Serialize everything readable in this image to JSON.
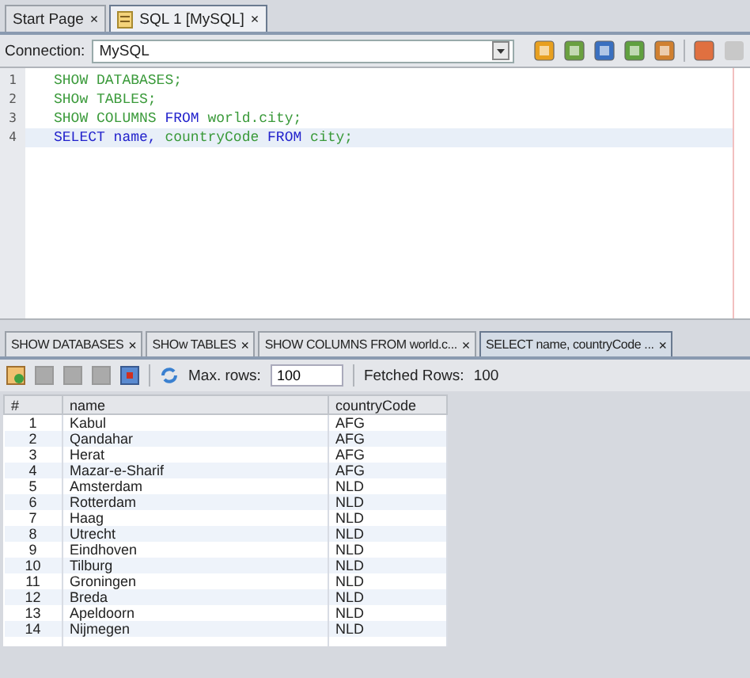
{
  "editor_tabs": [
    {
      "label": "Start Page",
      "close": "×",
      "selected": false,
      "icon": false
    },
    {
      "label": "SQL 1 [MySQL]",
      "close": "×",
      "selected": true,
      "icon": true
    }
  ],
  "connection": {
    "label": "Connection:",
    "value": "MySQL"
  },
  "code_lines": [
    {
      "number": "1",
      "current": false,
      "tokens": [
        {
          "text": "SHOW DATABASES;",
          "kind": "plain"
        }
      ]
    },
    {
      "number": "2",
      "current": false,
      "tokens": [
        {
          "text": "SHOw TABLES;",
          "kind": "plain"
        }
      ]
    },
    {
      "number": "3",
      "current": false,
      "tokens": [
        {
          "text": "SHOW COLUMNS ",
          "kind": "plain"
        },
        {
          "text": "FROM ",
          "kind": "keyword"
        },
        {
          "text": "world.city;",
          "kind": "plain"
        }
      ]
    },
    {
      "number": "4",
      "current": true,
      "tokens": [
        {
          "text": "SELECT name, ",
          "kind": "keyword"
        },
        {
          "text": "countryCode ",
          "kind": "plain"
        },
        {
          "text": "FROM ",
          "kind": "keyword"
        },
        {
          "text": "city;",
          "kind": "plain"
        }
      ]
    }
  ],
  "result_tabs": [
    {
      "label": "SHOW DATABASES",
      "close": "×",
      "selected": false
    },
    {
      "label": "SHOw TABLES",
      "close": "×",
      "selected": false
    },
    {
      "label": "SHOW COLUMNS FROM world.c...",
      "close": "×",
      "selected": false
    },
    {
      "label": "SELECT name, countryCode ...",
      "close": "×",
      "selected": true
    }
  ],
  "result_toolbar": {
    "max_rows_label": "Max. rows:",
    "max_rows": "100",
    "fetched_label": "Fetched Rows:",
    "fetched": "100"
  },
  "table": {
    "columns": [
      "#",
      "name",
      "countryCode"
    ],
    "rows": [
      [
        "1",
        "Kabul",
        "AFG"
      ],
      [
        "2",
        "Qandahar",
        "AFG"
      ],
      [
        "3",
        "Herat",
        "AFG"
      ],
      [
        "4",
        "Mazar-e-Sharif",
        "AFG"
      ],
      [
        "5",
        "Amsterdam",
        "NLD"
      ],
      [
        "6",
        "Rotterdam",
        "NLD"
      ],
      [
        "7",
        "Haag",
        "NLD"
      ],
      [
        "8",
        "Utrecht",
        "NLD"
      ],
      [
        "9",
        "Eindhoven",
        "NLD"
      ],
      [
        "10",
        "Tilburg",
        "NLD"
      ],
      [
        "11",
        "Groningen",
        "NLD"
      ],
      [
        "12",
        "Breda",
        "NLD"
      ],
      [
        "13",
        "Apeldoorn",
        "NLD"
      ],
      [
        "14",
        "Nijmegen",
        "NLD"
      ]
    ]
  }
}
